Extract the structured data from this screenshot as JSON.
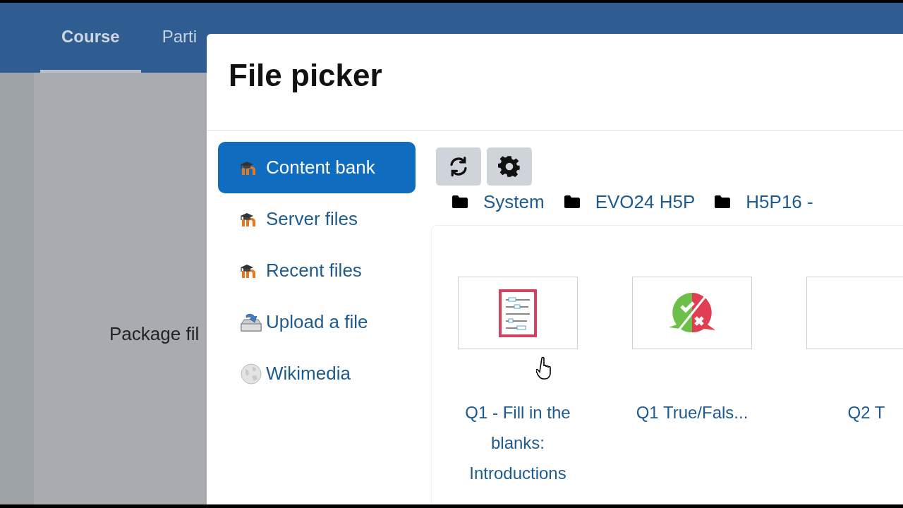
{
  "course_nav": {
    "tabs": [
      {
        "label": "Course",
        "selected": true
      },
      {
        "label": "Parti",
        "selected": false
      }
    ]
  },
  "background": {
    "label": "Package fil"
  },
  "dialog": {
    "title": "File picker",
    "repositories": [
      {
        "label": "Content bank",
        "kind": "moodle",
        "selected": true
      },
      {
        "label": "Server files",
        "kind": "moodle",
        "selected": false
      },
      {
        "label": "Recent files",
        "kind": "moodle",
        "selected": false
      },
      {
        "label": "Upload a file",
        "kind": "upload",
        "selected": false
      },
      {
        "label": "Wikimedia",
        "kind": "wikimedia",
        "selected": false
      }
    ],
    "toolbar": [
      {
        "kind": "refresh"
      },
      {
        "kind": "settings"
      }
    ],
    "breadcrumb": [
      "System",
      "EVO24 H5P",
      "H5P16 -"
    ],
    "files": [
      {
        "name": "Q1 - Fill in the blanks: Introductions",
        "kind": "fill-blanks"
      },
      {
        "name": "Q1 True/Fals...",
        "kind": "true-false"
      },
      {
        "name": "Q2 T",
        "kind": "blank"
      }
    ]
  }
}
